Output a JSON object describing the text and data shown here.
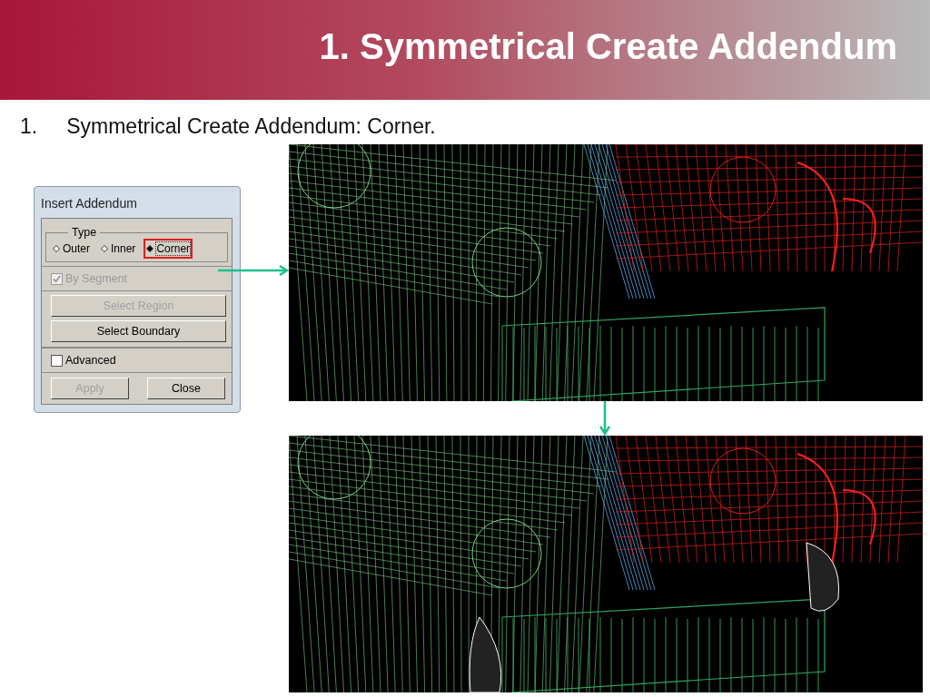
{
  "slide": {
    "title": "1. Symmetrical Create Addendum",
    "bullets": [
      {
        "number": "1.",
        "text": "Symmetrical Create Addendum: Corner."
      }
    ]
  },
  "dialog": {
    "title": "Insert Addendum",
    "type_group": {
      "label": "Type",
      "options": [
        {
          "label": "Outer",
          "selected": false,
          "highlighted": false
        },
        {
          "label": "Inner",
          "selected": false,
          "highlighted": false
        },
        {
          "label": "Corner",
          "selected": true,
          "highlighted": true
        }
      ]
    },
    "by_segment": {
      "label": "By Segment",
      "checked": true,
      "disabled": true
    },
    "buttons": [
      {
        "label": "Select Region",
        "disabled": true
      },
      {
        "label": "Select Boundary",
        "disabled": false
      }
    ],
    "advanced": {
      "label": "Advanced",
      "checked": false
    },
    "footer_buttons": [
      {
        "label": "Apply",
        "disabled": true
      },
      {
        "label": "Close",
        "disabled": false
      }
    ]
  },
  "views": [
    {
      "kind": "before"
    },
    {
      "kind": "after"
    }
  ]
}
